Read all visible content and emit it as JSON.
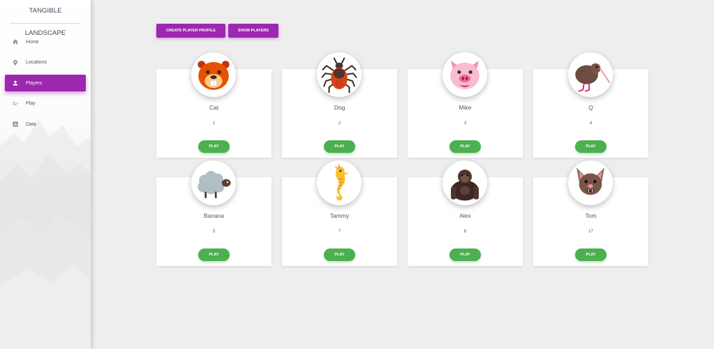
{
  "app": {
    "title": "TANGIBLE LANDSCAPE"
  },
  "sidebar": {
    "items": [
      {
        "label": "Home",
        "icon": "home-icon",
        "active": false
      },
      {
        "label": "Locations",
        "icon": "location-pin-icon",
        "active": false
      },
      {
        "label": "Players",
        "icon": "person-icon",
        "active": true
      },
      {
        "label": "Play",
        "icon": "trending-icon",
        "active": false
      },
      {
        "label": "Data",
        "icon": "bar-chart-icon",
        "active": false
      }
    ]
  },
  "toolbar": {
    "create_label": "CREATE PLAYER PROFILE",
    "show_label": "SHOW PLAYERS"
  },
  "players": [
    {
      "name": "Cat",
      "id": "1",
      "avatar": "beaver-icon",
      "play_label": "PLAY"
    },
    {
      "name": "Dog",
      "id": "2",
      "avatar": "tick-icon",
      "play_label": "PLAY"
    },
    {
      "name": "Mike",
      "id": "3",
      "avatar": "pig-icon",
      "play_label": "PLAY"
    },
    {
      "name": "Q",
      "id": "4",
      "avatar": "kiwi-bird-icon",
      "play_label": "PLAY"
    },
    {
      "name": "Banana",
      "id": "5",
      "avatar": "sheep-icon",
      "play_label": "PLAY"
    },
    {
      "name": "Tammy",
      "id": "7",
      "avatar": "seahorse-icon",
      "play_label": "PLAY"
    },
    {
      "name": "Alex",
      "id": "8",
      "avatar": "gorilla-icon",
      "play_label": "PLAY"
    },
    {
      "name": "Tom",
      "id": "17",
      "avatar": "bat-icon",
      "play_label": "PLAY"
    }
  ],
  "colors": {
    "accent": "#9c27b0",
    "play": "#4caf50",
    "background": "#eeeeee"
  }
}
